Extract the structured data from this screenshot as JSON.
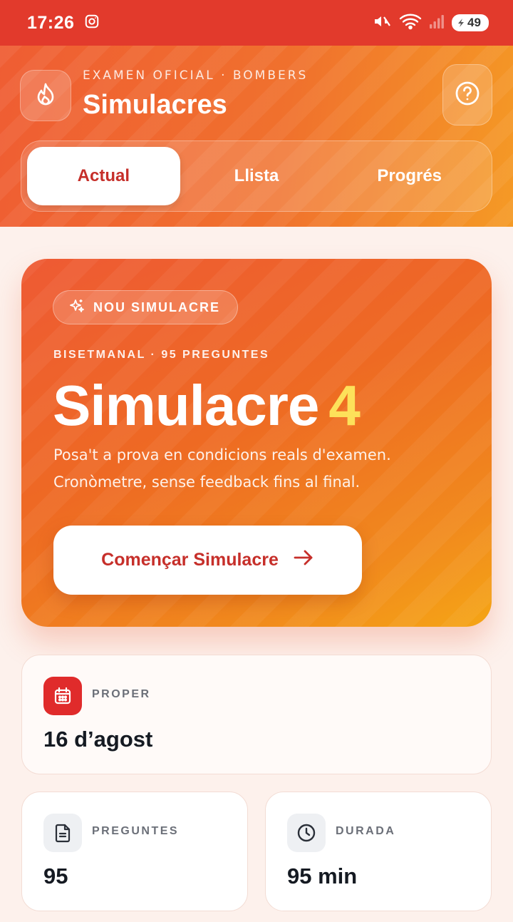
{
  "status_bar": {
    "time": "17:26",
    "battery": "49",
    "icons": [
      "instagram-icon",
      "mute-vibrate-icon",
      "wifi-icon",
      "signal-icon",
      "battery-icon"
    ]
  },
  "header": {
    "eyebrow": "EXAMEN OFICIAL · BOMBERS",
    "title": "Simulacres",
    "logo_icon": "flame-icon",
    "help_icon": "help-icon"
  },
  "tabs": [
    {
      "label": "Actual",
      "active": true
    },
    {
      "label": "Llista",
      "active": false
    },
    {
      "label": "Progrés",
      "active": false
    }
  ],
  "hero": {
    "badge": "NOU SIMULACRE",
    "badge_icon": "sparkles-icon",
    "eyebrow": "BISETMANAL · 95 PREGUNTES",
    "title_word": "Simulacre",
    "title_number": "4",
    "description": "Posa't a prova en condicions reals d'examen. Cronòmetre, sense feedback fins al final.",
    "button_label": "Començar Simulacre",
    "button_icon": "arrow-right-icon"
  },
  "stats": {
    "proper": {
      "label": "PROPER",
      "value": "16 d’agost",
      "icon": "calendar-icon"
    },
    "preguntes": {
      "label": "PREGUNTES",
      "value": "95",
      "icon": "document-icon"
    },
    "durada": {
      "label": "DURADA",
      "value": "95 min",
      "icon": "clock-icon"
    }
  },
  "colors": {
    "status_bar": "#e23a2c",
    "accent_red": "#c62f2a",
    "accent_orange": "#ef6a2a",
    "highlight_yellow": "#fde15a"
  }
}
